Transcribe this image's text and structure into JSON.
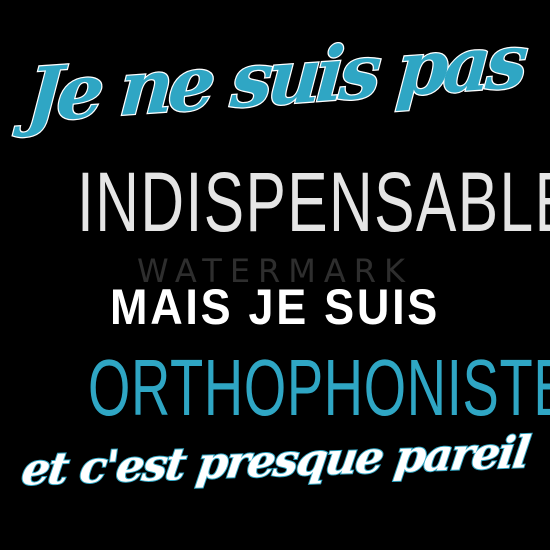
{
  "colors": {
    "background": "#000000",
    "accent_teal": "#2fa6c4",
    "white": "#ffffff"
  },
  "lines": {
    "line1": "Je ne suis pas",
    "line2": "INDISPENSABLE",
    "line3": "MAIS JE SUIS",
    "line4": "ORTHOPHONISTE",
    "line5": "et c'est presque pareil"
  },
  "watermark": "WATERMARK"
}
